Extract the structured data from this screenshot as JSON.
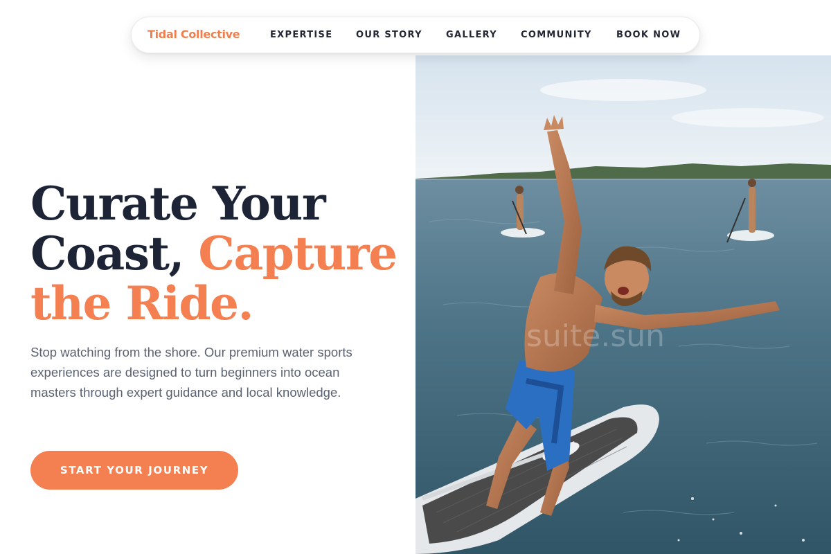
{
  "nav": {
    "brand": "Tidal Collective",
    "links": [
      "EXPERTISE",
      "OUR STORY",
      "GALLERY",
      "COMMUNITY",
      "BOOK NOW"
    ]
  },
  "hero": {
    "headline_part1": "Curate Your Coast, ",
    "headline_accent": "Capture the Ride.",
    "description": "Stop watching from the shore. Our premium water sports experiences are designed to turn beginners into ocean masters through expert guidance and local knowledge.",
    "cta_label": "START YOUR JOURNEY"
  },
  "photo": {
    "watermark": "suite.sun"
  },
  "colors": {
    "accent": "#f47f50",
    "heading": "#1d2435",
    "body": "#5a6170",
    "nav_text": "#232733"
  }
}
